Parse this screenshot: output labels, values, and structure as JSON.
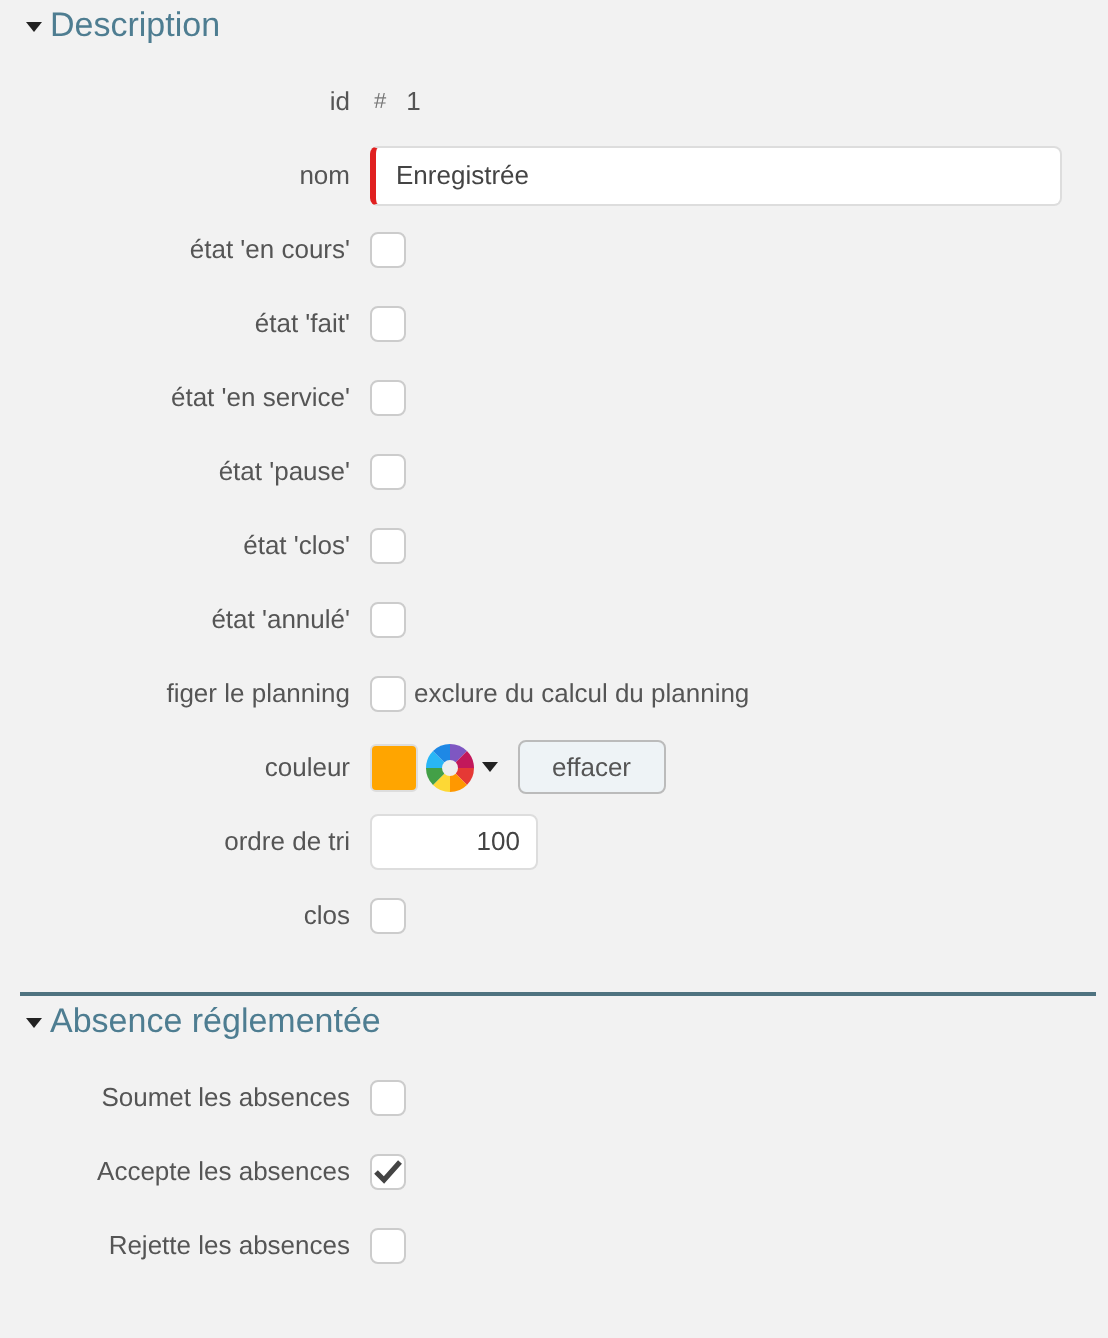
{
  "sections": [
    {
      "title": "Description",
      "expanded": true,
      "fields": [
        {
          "kind": "id",
          "label": "id",
          "prefix": "#",
          "value": "1"
        },
        {
          "kind": "text",
          "label": "nom",
          "value": "Enregistrée",
          "required": true
        },
        {
          "kind": "checkbox",
          "label": "état 'en cours'",
          "checked": false
        },
        {
          "kind": "checkbox",
          "label": "état 'fait'",
          "checked": false
        },
        {
          "kind": "checkbox",
          "label": "état 'en service'",
          "checked": false
        },
        {
          "kind": "checkbox",
          "label": "état 'pause'",
          "checked": false
        },
        {
          "kind": "checkbox",
          "label": "état 'clos'",
          "checked": false
        },
        {
          "kind": "checkbox",
          "label": "état 'annulé'",
          "checked": false
        },
        {
          "kind": "checkbox",
          "label": "figer le planning",
          "checked": false,
          "note": "exclure du calcul du planning"
        },
        {
          "kind": "color",
          "label": "couleur",
          "color": "#ffa500",
          "button": "effacer"
        },
        {
          "kind": "number",
          "label": "ordre de tri",
          "value": "100"
        },
        {
          "kind": "checkbox",
          "label": "clos",
          "checked": false
        }
      ]
    },
    {
      "title": "Absence réglementée",
      "expanded": true,
      "fields": [
        {
          "kind": "checkbox",
          "label": "Soumet les absences",
          "checked": false
        },
        {
          "kind": "checkbox",
          "label": "Accepte les absences",
          "checked": true
        },
        {
          "kind": "checkbox",
          "label": "Rejette les absences",
          "checked": false
        }
      ]
    }
  ]
}
